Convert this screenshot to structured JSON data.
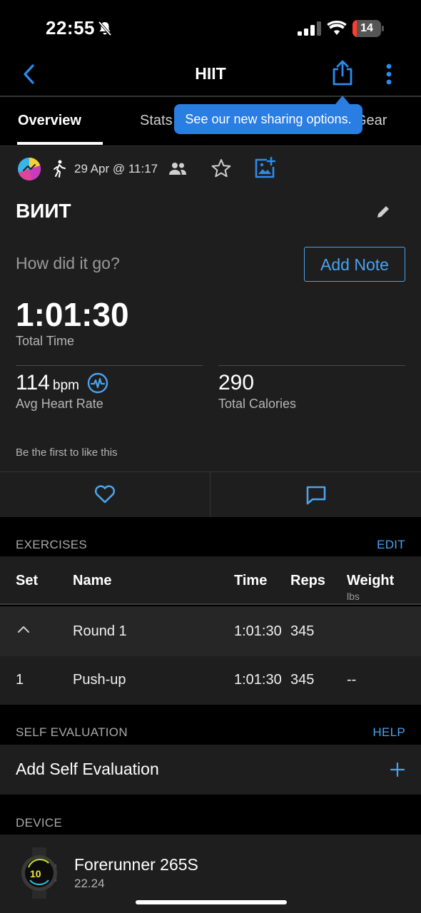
{
  "status_bar": {
    "time": "22:55",
    "battery_level": "14",
    "battery_fraction": 0.14
  },
  "nav": {
    "title": "HIIT"
  },
  "tabs": [
    {
      "label": "Overview",
      "active": true
    },
    {
      "label": "Stats",
      "active": false
    },
    {
      "label": "Gear",
      "active": false
    }
  ],
  "tooltip": {
    "text": "See our new sharing options."
  },
  "activity": {
    "date": "29 Apr @ 11:17",
    "title": "ВИИТ",
    "prompt": "How did it go?",
    "add_note_label": "Add Note",
    "total_time": "1:01:30",
    "total_time_label": "Total Time",
    "avg_hr_value": "114",
    "avg_hr_unit": "bpm",
    "avg_hr_label": "Avg Heart Rate",
    "calories_value": "290",
    "calories_label": "Total Calories",
    "like_text": "Be the first to like this"
  },
  "exercises": {
    "section_label": "EXERCISES",
    "action_label": "EDIT",
    "headers": {
      "set": "Set",
      "name": "Name",
      "time": "Time",
      "reps": "Reps",
      "weight": "Weight",
      "weight_unit": "lbs"
    },
    "round": {
      "name": "Round 1",
      "time": "1:01:30",
      "reps": "345"
    },
    "rows": [
      {
        "set": "1",
        "name": "Push-up",
        "time": "1:01:30",
        "reps": "345",
        "weight": "--"
      }
    ]
  },
  "self_evaluation": {
    "section_label": "SELF EVALUATION",
    "action_label": "HELP",
    "row_label": "Add Self Evaluation"
  },
  "device": {
    "section_label": "DEVICE",
    "name": "Forerunner 265S",
    "version": "22.24",
    "watch_face_digits": "10"
  },
  "colors": {
    "accent": "#4aa3f0",
    "tooltip": "#2a7de1",
    "battery_low": "#ff3b30"
  },
  "icons": {
    "back": "chevron-left-icon",
    "share": "share-icon",
    "more": "more-vertical-icon",
    "heart": "heart-icon",
    "comment": "comment-icon",
    "plus": "plus-icon"
  }
}
